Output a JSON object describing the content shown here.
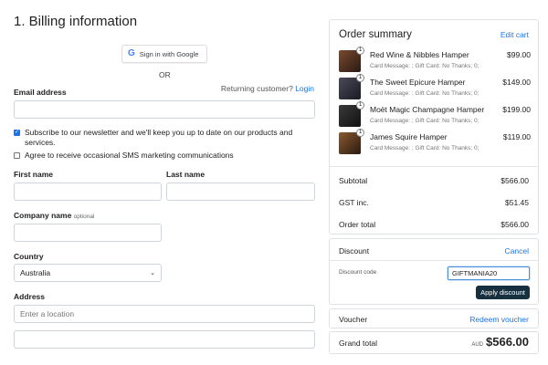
{
  "billing": {
    "title": "1. Billing information",
    "google_button": "Sign in with Google",
    "or": "OR",
    "email_label": "Email address",
    "returning_text": "Returning customer?",
    "login_link": "Login",
    "newsletter": "Subscribe to our newsletter and we'll keep you up to date on our products and services.",
    "newsletter_checked": true,
    "sms": "Agree to receive occasional SMS marketing communications",
    "sms_checked": false,
    "first_name_label": "First name",
    "last_name_label": "Last name",
    "company_label": "Company name",
    "company_optional": "optional",
    "country_label": "Country",
    "country_value": "Australia",
    "address_label": "Address",
    "address_placeholder": "Enter a location"
  },
  "summary": {
    "title": "Order summary",
    "edit_cart": "Edit cart",
    "items": [
      {
        "name": "Red Wine & Nibbles Hamper",
        "meta": "Card Message: ; Gift Card: No Thanks; 0;",
        "price": "$99.00",
        "qty": "1",
        "color": "#5a3a2a"
      },
      {
        "name": "The Sweet Epicure Hamper",
        "meta": "Card Message: ; Gift Card: No Thanks; 0;",
        "price": "$149.00",
        "qty": "1",
        "color": "#3a3a4a"
      },
      {
        "name": "Moët Magic Champagne Hamper",
        "meta": "Card Message: ; Gift Card: No Thanks; 0;",
        "price": "$199.00",
        "qty": "1",
        "color": "#2f2f2f"
      },
      {
        "name": "James Squire Hamper",
        "meta": "Card Message: ; Gift Card: No Thanks; 0;",
        "price": "$119.00",
        "qty": "1",
        "color": "#6a4a2a"
      }
    ],
    "subtotal_label": "Subtotal",
    "subtotal": "$566.00",
    "gst_label": "GST inc.",
    "gst": "$51.45",
    "order_total_label": "Order total",
    "order_total": "$566.00"
  },
  "discount": {
    "title": "Discount",
    "cancel": "Cancel",
    "code_label": "Discount code",
    "code_value": "GIFTMANIA20",
    "apply": "Apply discount"
  },
  "voucher": {
    "label": "Voucher",
    "redeem": "Redeem voucher"
  },
  "grand": {
    "label": "Grand total",
    "currency": "AUD",
    "amount": "$566.00"
  },
  "colors": {
    "link": "#1a73e8",
    "apply_button": "#163040"
  }
}
